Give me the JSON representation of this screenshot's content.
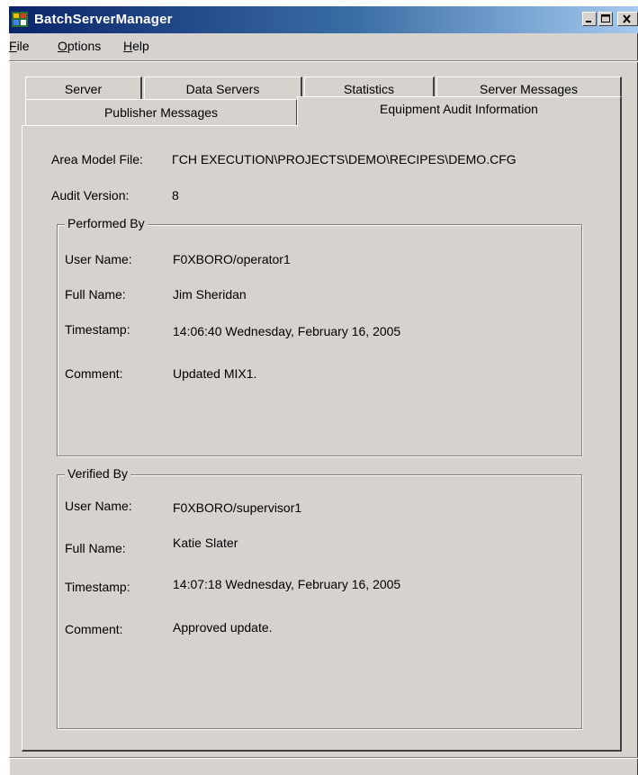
{
  "window": {
    "title": "BatchServerManager",
    "colors": {
      "titlebar_start": "#0a246a",
      "titlebar_end": "#a6caf0",
      "face": "#d6d3ce"
    }
  },
  "menu": {
    "file": {
      "mnemonic": "F",
      "rest": "ile"
    },
    "options": {
      "mnemonic": "O",
      "rest": "ptions"
    },
    "help": {
      "mnemonic": "H",
      "rest": "elp"
    }
  },
  "tabs": {
    "row1": [
      "Server",
      "Data Servers",
      "Statistics",
      "Server Messages"
    ],
    "row2": [
      "Publisher Messages",
      "Equipment Audit Information"
    ],
    "active": "Equipment Audit Information"
  },
  "audit": {
    "area_model_label": "Area Model File:",
    "area_model_value": "ΓCH EXECUTION\\PROJECTS\\DEMO\\RECIPES\\DEMO.CFG",
    "version_label": "Audit Version:",
    "version_value": "8"
  },
  "performed_by": {
    "legend": "Performed By",
    "user_label": "User Name:",
    "user_value": "F0XBORO/operator1",
    "full_label": "Full Name:",
    "full_value": "Jim Sheridan",
    "time_label": "Timestamp:",
    "time_value": "14:06:40 Wednesday, February 16, 2005",
    "comment_label": "Comment:",
    "comment_value": "Updated MIX1."
  },
  "verified_by": {
    "legend": "Verified By",
    "user_label": "User Name:",
    "user_value": "F0XBORO/supervisor1",
    "full_label": "Full Name:",
    "full_value": "Katie Slater",
    "time_label": "Timestamp:",
    "time_value": "14:07:18 Wednesday, February 16, 2005",
    "comment_label": "Comment:",
    "comment_value": "Approved update."
  },
  "icons": [
    "app-icon",
    "minimize-icon",
    "maximize-icon",
    "close-icon"
  ]
}
